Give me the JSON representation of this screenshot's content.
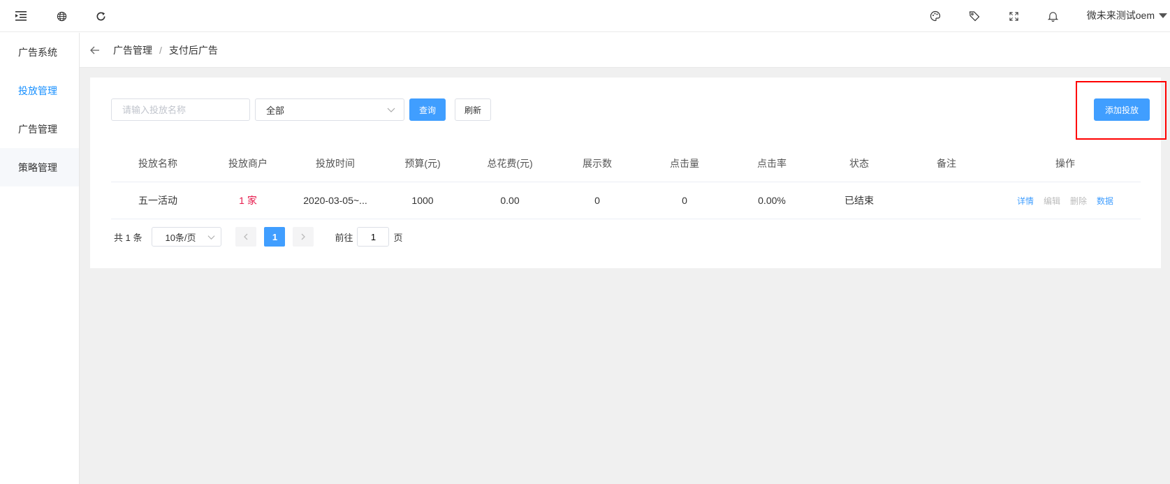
{
  "topbar": {
    "icons": [
      "menu-fold-icon",
      "globe-icon",
      "refresh-icon",
      "palette-icon",
      "tag-icon",
      "fullscreen-icon",
      "bell-icon"
    ],
    "user_name": "微未来测试oem"
  },
  "sidebar": {
    "items": [
      {
        "label": "广告系统",
        "active": false
      },
      {
        "label": "投放管理",
        "active": true
      },
      {
        "label": "广告管理",
        "active": false
      },
      {
        "label": "策略管理",
        "active": false
      }
    ]
  },
  "breadcrumb": {
    "items": [
      "广告管理",
      "支付后广告"
    ],
    "separator": "/"
  },
  "filters": {
    "name_placeholder": "请输入投放名称",
    "name_value": "",
    "status_select": "全部",
    "query_label": "查询",
    "refresh_label": "刷新",
    "add_label": "添加投放"
  },
  "table": {
    "headers": [
      "投放名称",
      "投放商户",
      "投放时间",
      "预算(元)",
      "总花费(元)",
      "展示数",
      "点击量",
      "点击率",
      "状态",
      "备注",
      "操作"
    ],
    "rows": [
      {
        "name": "五一活动",
        "merchant": "1 家",
        "time": "2020-03-05~...",
        "budget": "1000",
        "spend": "0.00",
        "impressions": "0",
        "clicks": "0",
        "ctr": "0.00%",
        "status": "已结束",
        "remark": "",
        "ops": {
          "detail": "详情",
          "edit": "编辑",
          "delete": "删除",
          "data": "数据"
        }
      }
    ]
  },
  "pagination": {
    "total_text": "共 1 条",
    "page_size": "10条/页",
    "current_page": "1",
    "goto_prefix": "前往",
    "goto_value": "1",
    "goto_suffix": "页"
  },
  "colors": {
    "accent": "#409eff",
    "sidebar_active": "#1890ff",
    "merchant_text": "#e6194b",
    "highlight_border": "#ff0000",
    "page_bg": "#f0f0f0"
  }
}
